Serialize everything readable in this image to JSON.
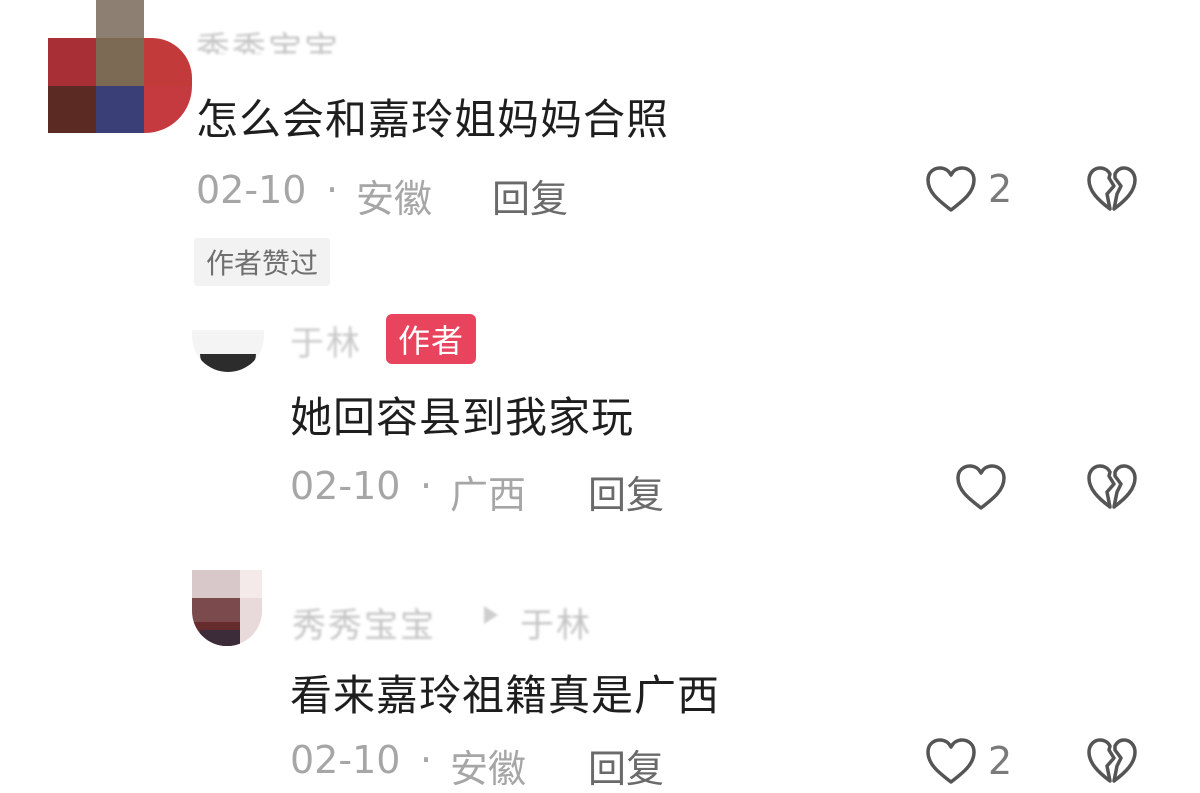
{
  "comments": [
    {
      "username": "秀秀宝宝",
      "content": "怎么会和嘉玲姐妈妈合照",
      "date": "02-10",
      "separator": "·",
      "location": "安徽",
      "reply_label": "回复",
      "like_count": "2",
      "liked_by_author_label": "作者赞过"
    },
    {
      "username": "于林",
      "author_badge": "作者",
      "content": "她回容县到我家玩",
      "date": "02-10",
      "separator": "·",
      "location": "广西",
      "reply_label": "回复"
    },
    {
      "username": "秀秀宝宝",
      "reply_to": "于林",
      "content": "看来嘉玲祖籍真是广西",
      "date": "02-10",
      "separator": "·",
      "location": "安徽",
      "reply_label": "回复",
      "like_count": "2"
    }
  ],
  "icons": {
    "like": "heart-outline-icon",
    "dislike": "broken-heart-icon"
  },
  "colors": {
    "author_badge_bg": "#e9445d",
    "liked_badge_bg": "#f2f2f2",
    "meta_text": "#a6a6a6"
  }
}
